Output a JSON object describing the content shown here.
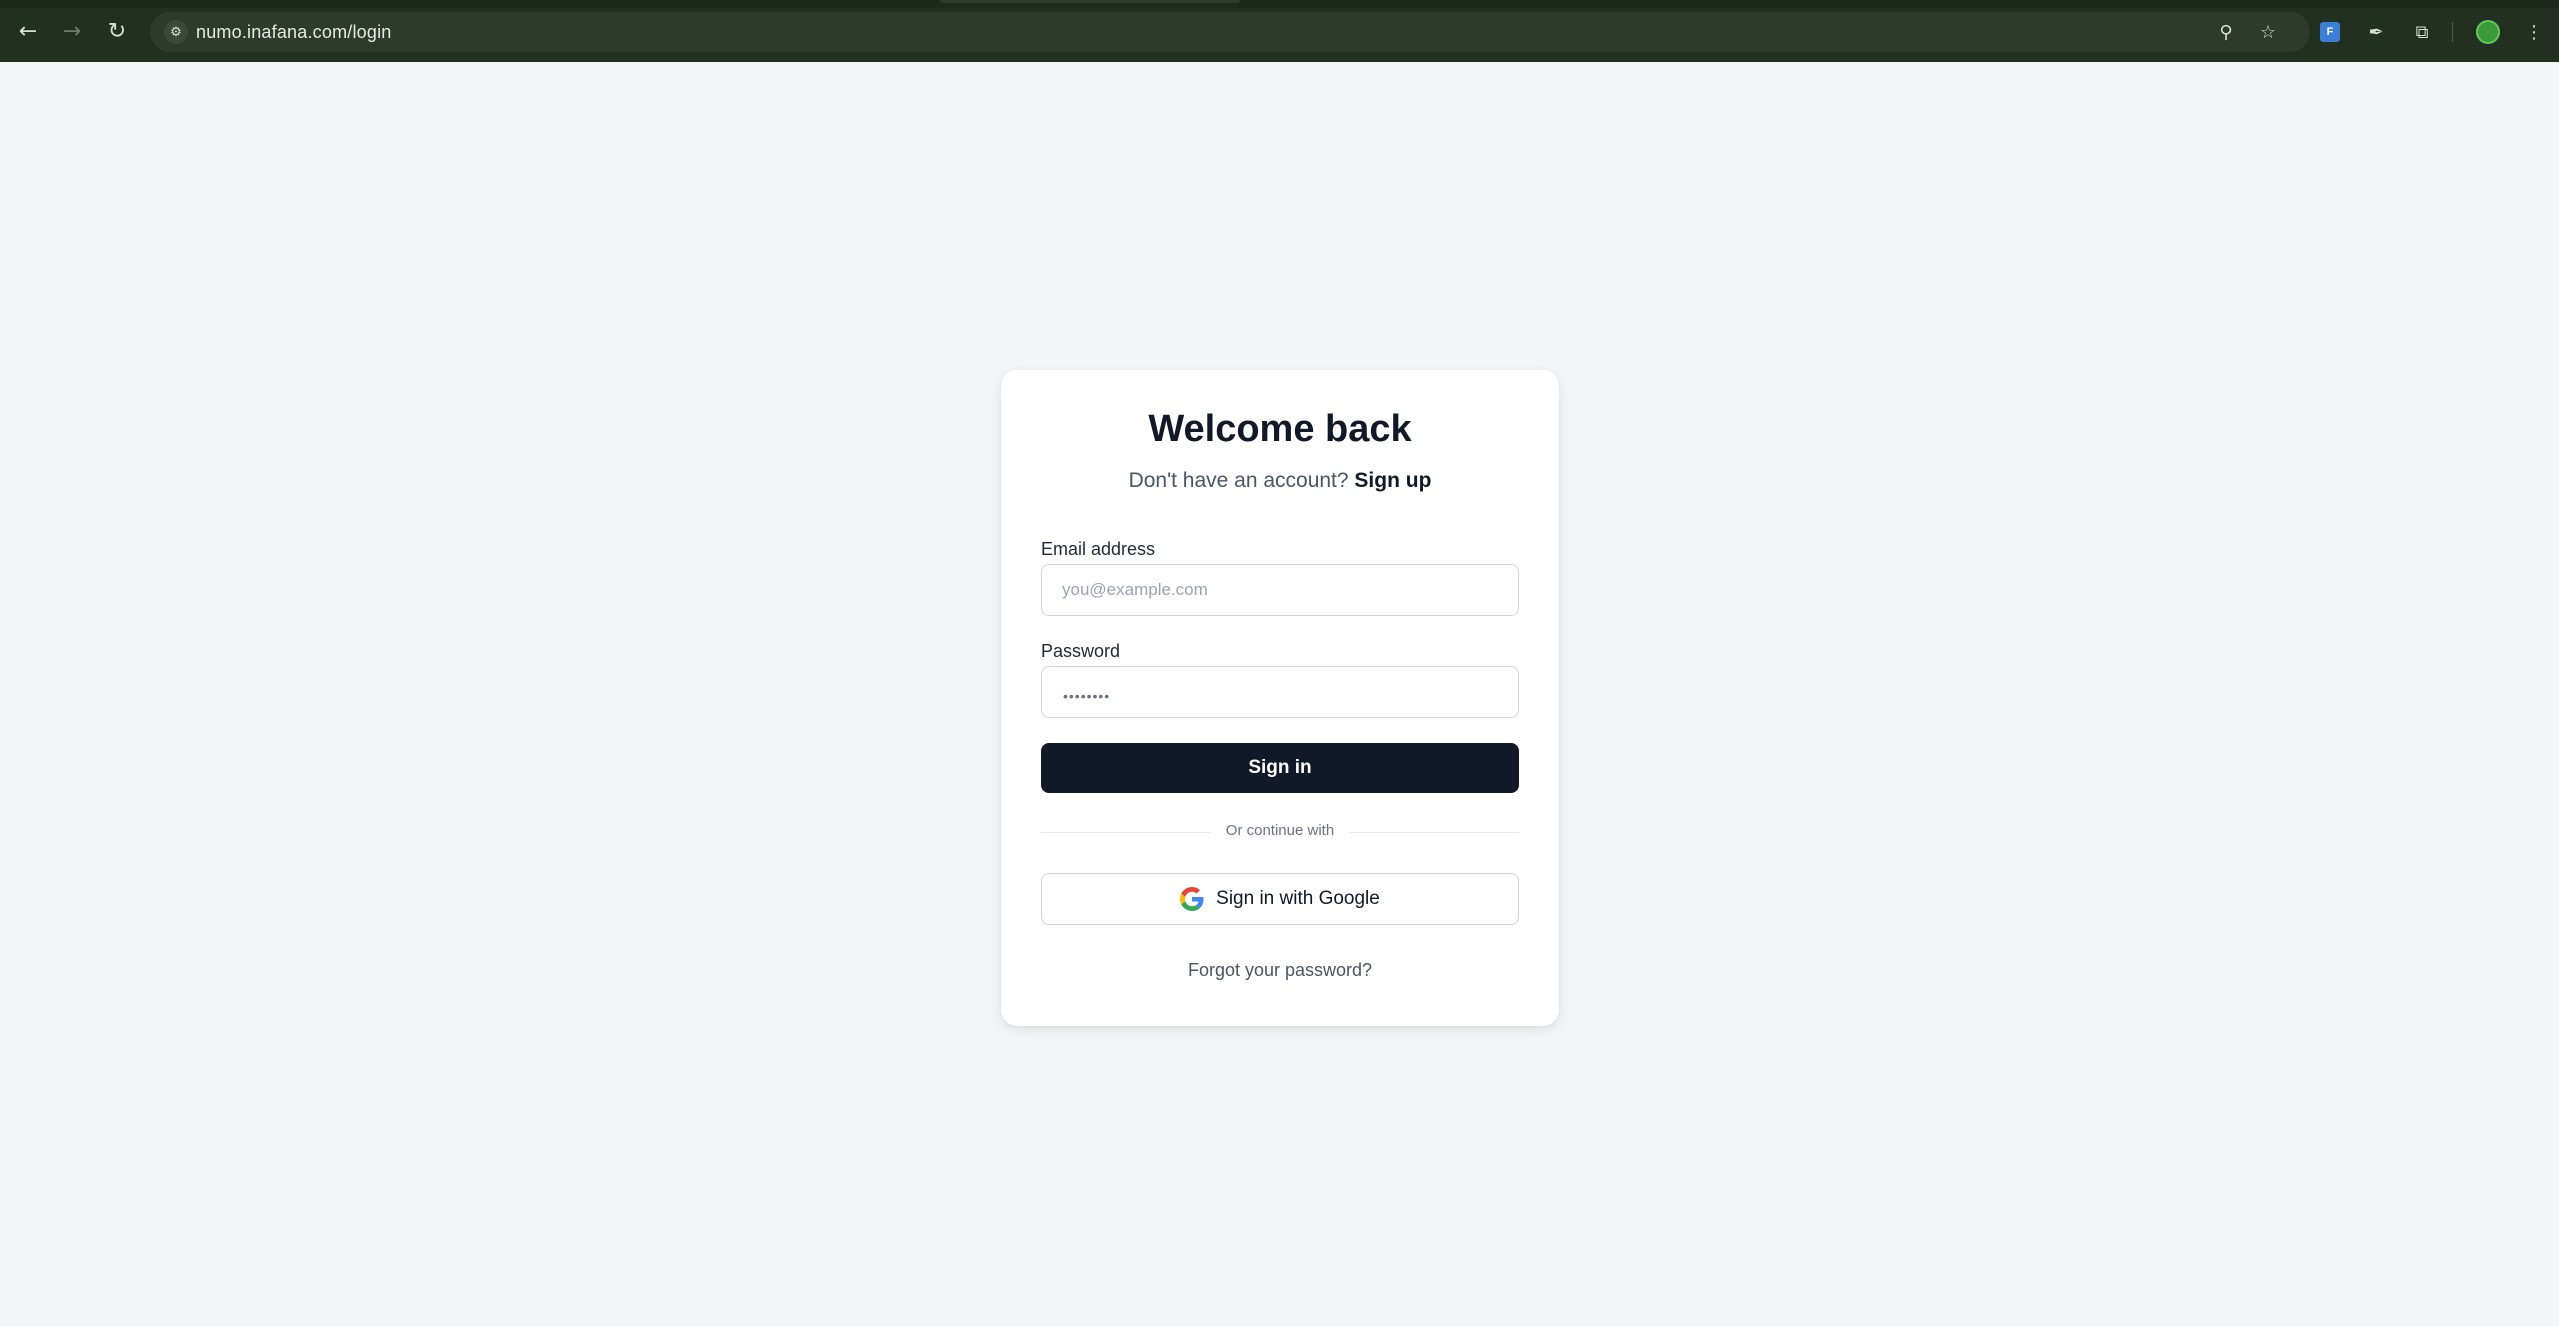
{
  "browser": {
    "url": "numo.inafana.com/login",
    "icons": {
      "back": "back-arrow-icon",
      "forward": "forward-arrow-icon",
      "reload": "reload-icon",
      "site_info": "site-settings-icon",
      "password": "key-icon",
      "bookmark": "star-icon",
      "extension": "extension-icon",
      "extensions": "puzzle-icon",
      "profile": "profile-icon",
      "menu": "more-vert-icon"
    },
    "extension_badge": "F"
  },
  "login": {
    "title": "Welcome back",
    "subtitle_prefix": "Don't have an account?",
    "signup_link": "Sign up",
    "email_label": "Email address",
    "email_placeholder": "you@example.com",
    "email_value": "",
    "password_label": "Password",
    "password_mask": "••••••••",
    "signin_button": "Sign in",
    "divider_text": "Or continue with",
    "google_button": "Sign in with Google",
    "forgot_link": "Forgot your password?"
  },
  "colors": {
    "page_bg": "#f4f5f7",
    "primary": "#111827",
    "chrome_bg": "#22301f"
  }
}
